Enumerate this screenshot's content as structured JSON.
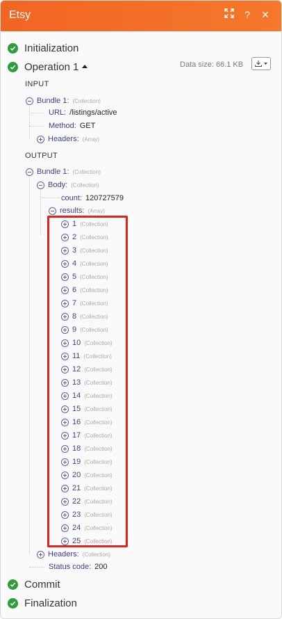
{
  "header": {
    "title": "Etsy"
  },
  "phases": {
    "initialization": "Initialization",
    "operation": "Operation 1",
    "commit": "Commit",
    "finalization": "Finalization"
  },
  "datasize": "Data size: 66.1 KB",
  "input": {
    "label": "INPUT",
    "bundle": {
      "key": "Bundle 1:",
      "type": "(Collection)"
    },
    "url": {
      "key": "URL:",
      "value": "/listings/active"
    },
    "method": {
      "key": "Method:",
      "value": "GET"
    },
    "headers": {
      "key": "Headers:",
      "type": "(Array)"
    }
  },
  "output": {
    "label": "OUTPUT",
    "bundle": {
      "key": "Bundle 1:",
      "type": "(Collection)"
    },
    "body": {
      "key": "Body:",
      "type": "(Collection)"
    },
    "count": {
      "key": "count:",
      "value": "120727579"
    },
    "results": {
      "key": "results:",
      "type": "(Array)"
    },
    "items": [
      {
        "key": "1",
        "type": "(Collection)"
      },
      {
        "key": "2",
        "type": "(Collection)"
      },
      {
        "key": "3",
        "type": "(Collection)"
      },
      {
        "key": "4",
        "type": "(Collection)"
      },
      {
        "key": "5",
        "type": "(Collection)"
      },
      {
        "key": "6",
        "type": "(Collection)"
      },
      {
        "key": "7",
        "type": "(Collection)"
      },
      {
        "key": "8",
        "type": "(Collection)"
      },
      {
        "key": "9",
        "type": "(Collection)"
      },
      {
        "key": "10",
        "type": "(Collection)"
      },
      {
        "key": "11",
        "type": "(Collection)"
      },
      {
        "key": "12",
        "type": "(Collection)"
      },
      {
        "key": "13",
        "type": "(Collection)"
      },
      {
        "key": "14",
        "type": "(Collection)"
      },
      {
        "key": "15",
        "type": "(Collection)"
      },
      {
        "key": "16",
        "type": "(Collection)"
      },
      {
        "key": "17",
        "type": "(Collection)"
      },
      {
        "key": "18",
        "type": "(Collection)"
      },
      {
        "key": "19",
        "type": "(Collection)"
      },
      {
        "key": "20",
        "type": "(Collection)"
      },
      {
        "key": "21",
        "type": "(Collection)"
      },
      {
        "key": "22",
        "type": "(Collection)"
      },
      {
        "key": "23",
        "type": "(Collection)"
      },
      {
        "key": "24",
        "type": "(Collection)"
      },
      {
        "key": "25",
        "type": "(Collection)"
      }
    ],
    "headers": {
      "key": "Headers:",
      "type": "(Collection)"
    },
    "status": {
      "key": "Status code:",
      "value": "200"
    }
  },
  "colors": {
    "header": "#f26522",
    "success": "#2e9d3a",
    "highlight": "#e2231a",
    "key_text": "#3d3f8f"
  },
  "icons": [
    "expand-icon",
    "help-icon",
    "close-icon",
    "check-icon",
    "download-icon"
  ]
}
